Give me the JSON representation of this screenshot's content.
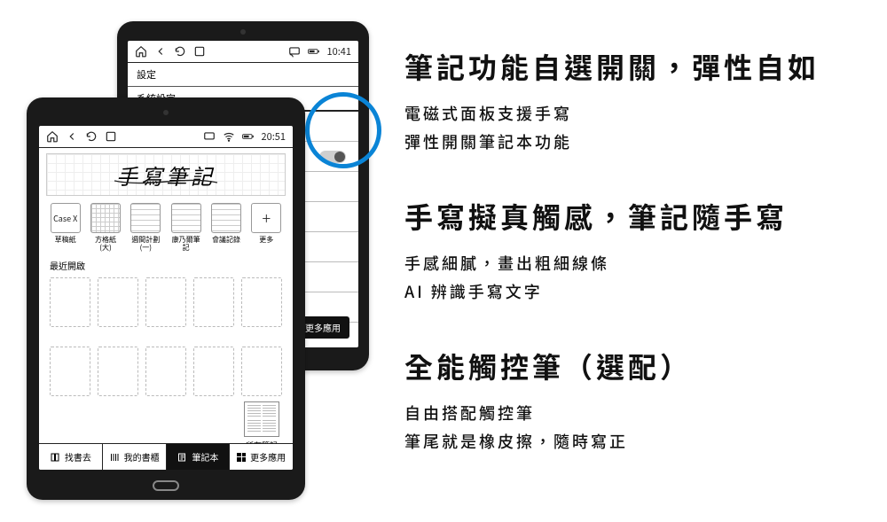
{
  "marketing": {
    "blocks": [
      {
        "title": "筆記功能自選開關，彈性自如",
        "lines": [
          "電磁式面板支援手寫",
          "彈性開關筆記本功能"
        ]
      },
      {
        "title": "手寫擬真觸感，筆記隨手寫",
        "lines": [
          "手感細膩，畫出粗細線條",
          "AI 辨識手寫文字"
        ]
      },
      {
        "title": "全能觸控筆（選配）",
        "lines": [
          "自由搭配觸控筆",
          "筆尾就是橡皮擦，隨時寫正"
        ]
      }
    ]
  },
  "tabA": {
    "status": {
      "time": "10:41"
    },
    "title": "設定",
    "subtitle": "系統設定",
    "more_label": "更多應用"
  },
  "tabB": {
    "status": {
      "time": "20:51"
    },
    "heading": "手寫筆記",
    "templates": [
      {
        "label": "草稿紙",
        "kind": "text",
        "thumb_text": "Case X"
      },
      {
        "label": "方格紙\n(大)",
        "kind": "grid"
      },
      {
        "label": "週間計劃\n(一)",
        "kind": "lines"
      },
      {
        "label": "康乃爾筆記",
        "kind": "lines"
      },
      {
        "label": "會議記錄",
        "kind": "lines"
      },
      {
        "label": "更多",
        "kind": "plus",
        "thumb_text": "+"
      }
    ],
    "recent_label": "最近開啟",
    "all_notes_label": "所有筆記",
    "tabs": [
      {
        "label": "找書去",
        "icon": "book"
      },
      {
        "label": "我的書櫃",
        "icon": "shelf"
      },
      {
        "label": "筆記本",
        "icon": "note",
        "active": true
      },
      {
        "label": "更多應用",
        "icon": "grid"
      }
    ]
  }
}
